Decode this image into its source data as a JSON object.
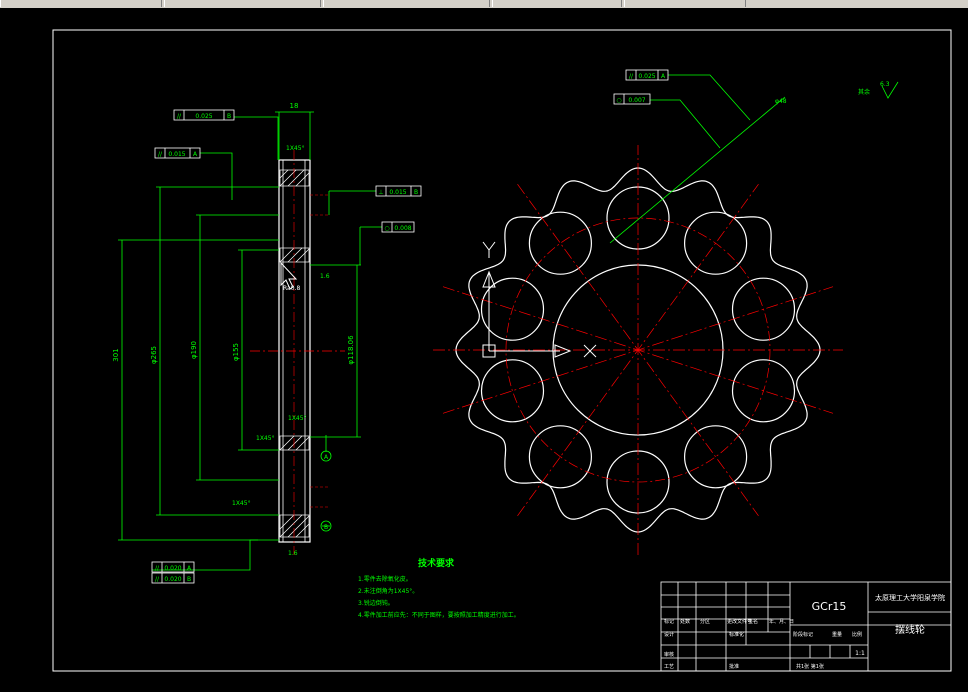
{
  "title_block": {
    "material": "GCr15",
    "school": "太原理工大学阳泉学院",
    "part_name": "摆线轮",
    "scale": "1:1",
    "header_row": [
      "标记",
      "处数",
      "分区",
      "更改文件号",
      "签名",
      "年、月、日"
    ],
    "row_design": [
      "设计",
      "",
      "",
      "标准化"
    ],
    "row_review": "审核",
    "row_process": "工艺",
    "row_approve": "批准",
    "stage_labels": [
      "阶段标记",
      "重量",
      "比例"
    ],
    "sheet_info": "共1张  第1张"
  },
  "tech_notes": {
    "title": "技术要求",
    "items": [
      "1.零件去除氧化皮。",
      "2.未注倒角为1X45°。",
      "3.锐边倒钝。",
      "4.零件加工前应先：不同于图样，要按照加工精度进行加工。"
    ]
  },
  "tolerance_frames": {
    "left_top1": {
      "sym": "//",
      "val": "0.025",
      "ref": "B"
    },
    "left_top2": {
      "sym": "//",
      "val": "0.015",
      "ref": "A"
    },
    "right_perp": {
      "sym": "⊥",
      "val": "0.015",
      "ref": "B"
    },
    "right_circ": {
      "sym": "○",
      "val": "0.008"
    },
    "bottom1": {
      "sym": "//",
      "val": "0.020",
      "ref": "A"
    },
    "bottom2": {
      "sym": "//",
      "val": "0.020",
      "ref": "B"
    },
    "gear_top": {
      "sym": "//",
      "val": "0.025",
      "ref": "A"
    },
    "gear_circ": {
      "sym": "○",
      "val": "0.007"
    }
  },
  "dim_labels": {
    "roughness_top": "其余",
    "roughness_val": "6.3",
    "ra_1": "Ra0.8",
    "ra_2": "1.6",
    "ra_3": "1.6",
    "chamfer1": "1X45°",
    "chamfer2": "1X45°",
    "chamfer3": "1X45°",
    "chamfer4": "1X45°",
    "width_top": "18",
    "d_outer": "301",
    "d_root": "φ265",
    "d_bolt": "φ190",
    "d_inner": "φ155",
    "d_bore": "φ118.06",
    "datum_A": "A",
    "datum_B": "B",
    "hole_label": "φ48"
  },
  "colors": {
    "outline": "#ffffff",
    "dimension": "#00ff00",
    "centerline": "#ff0000",
    "frame": "#ffffff",
    "hatch": "#ffffff"
  },
  "gear": {
    "lobes": 16,
    "pin_holes": 10
  }
}
